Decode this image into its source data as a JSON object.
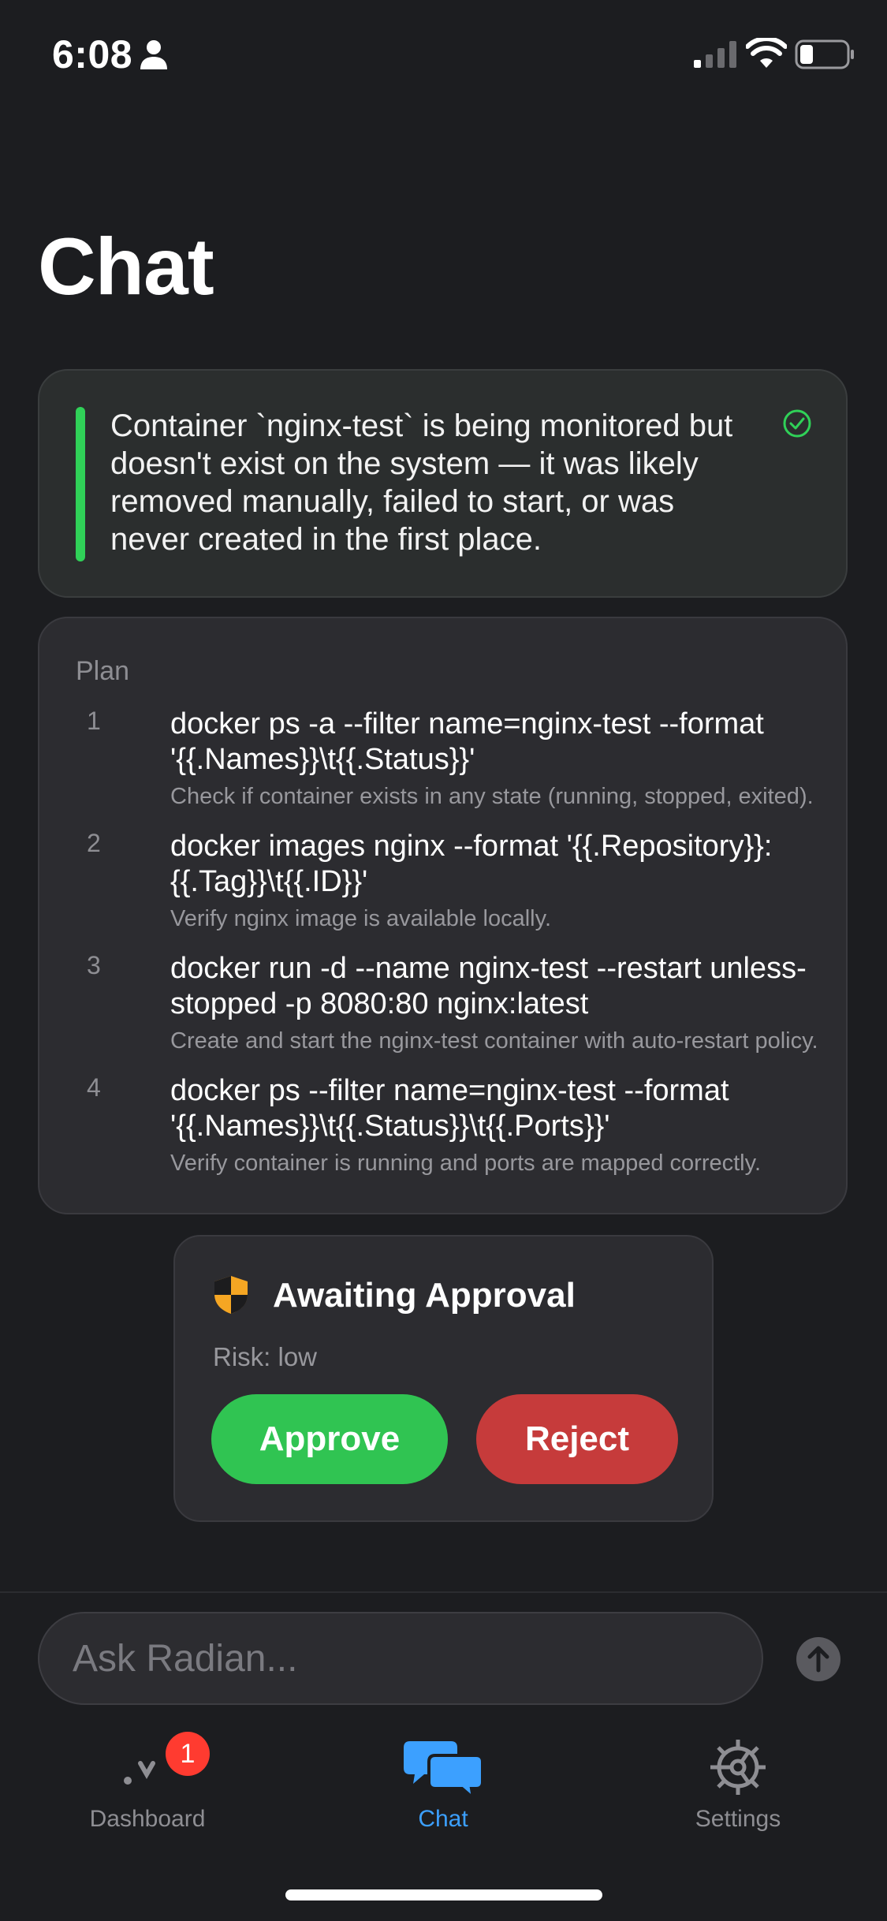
{
  "status_bar": {
    "time": "6:08"
  },
  "header": {
    "title": "Chat"
  },
  "diagnosis": {
    "text": "Container `nginx-test` is being monitored but doesn't exist on the system — it was likely removed manually, failed to start, or was never created in the first place."
  },
  "plan": {
    "label": "Plan",
    "steps": [
      {
        "num": "1",
        "command": "docker ps -a --filter name=nginx-test --format '{{.Names}}\\t{{.Status}}'",
        "description": "Check if container exists in any state (running, stopped, exited)."
      },
      {
        "num": "2",
        "command": "docker images nginx --format '{{.Repository}}:{{.Tag}}\\t{{.ID}}'",
        "description": "Verify nginx image is available locally."
      },
      {
        "num": "3",
        "command": "docker run -d --name nginx-test --restart unless-stopped -p 8080:80 nginx:latest",
        "description": "Create and start the nginx-test container with auto-restart policy."
      },
      {
        "num": "4",
        "command": "docker ps --filter name=nginx-test --format '{{.Names}}\\t{{.Status}}\\t{{.Ports}}'",
        "description": "Verify container is running and ports are mapped correctly."
      }
    ]
  },
  "approval": {
    "title": "Awaiting Approval",
    "risk": "Risk: low",
    "approve_label": "Approve",
    "reject_label": "Reject"
  },
  "composer": {
    "placeholder": "Ask Radian..."
  },
  "tabs": [
    {
      "label": "Dashboard",
      "badge": "1",
      "active": false
    },
    {
      "label": "Chat",
      "active": true
    },
    {
      "label": "Settings",
      "active": false
    }
  ],
  "colors": {
    "accent": "#3ca0ff",
    "success": "#30d158",
    "danger": "#c63b3b",
    "warning": "#f5a623",
    "inactive_tab": "#8e8e93"
  },
  "icons": [
    "person-icon",
    "signal-icon",
    "wifi-icon",
    "battery-icon",
    "check-circle-icon",
    "shield-icon",
    "send-arrow-icon",
    "dashboard-icon",
    "chat-bubbles-icon",
    "gear-icon"
  ]
}
